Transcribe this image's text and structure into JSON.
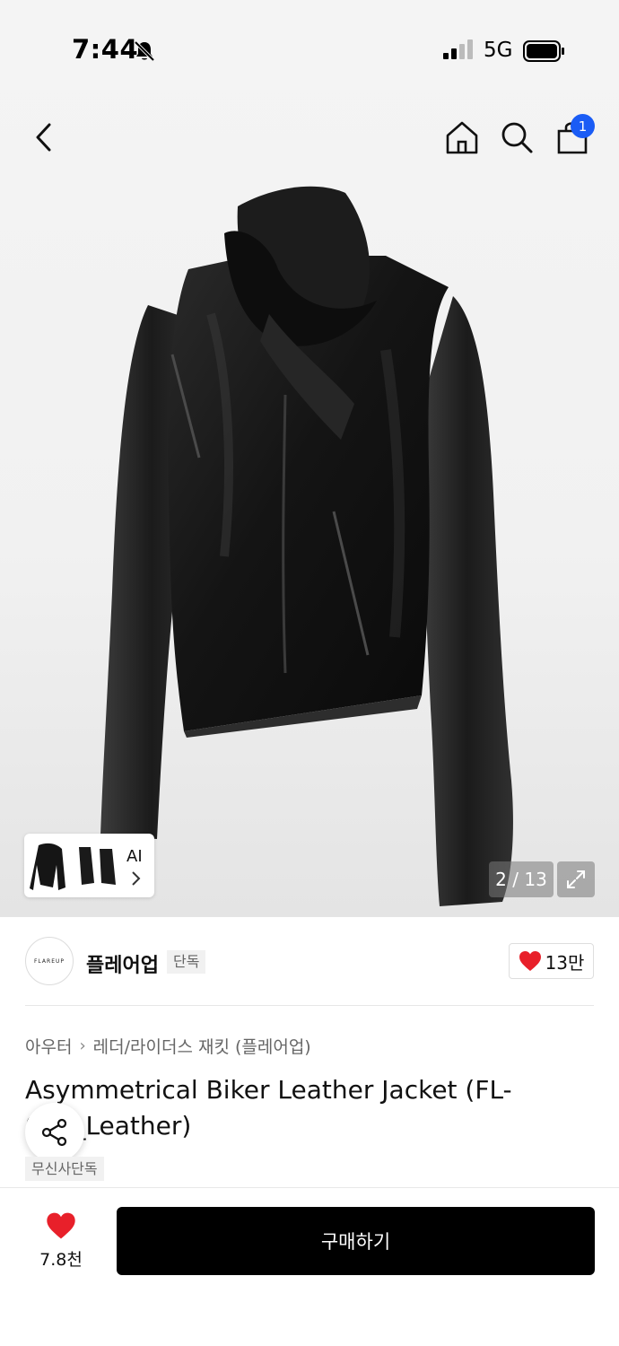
{
  "status_bar": {
    "time": "7:44",
    "network": "5G"
  },
  "header": {
    "cart_count": "1"
  },
  "gallery": {
    "ai_label": "AI",
    "counter": "2 / 13"
  },
  "brand": {
    "logo_text": "FLAREUP",
    "name": "플레어업",
    "badge": "단독",
    "likes": "13만"
  },
  "product": {
    "category": [
      "아우터",
      "레더/라이더스 재킷 (플레어업)"
    ],
    "title": "Asymmetrical Biker Leather Jacket (FL-047_Leather)",
    "exclusive_badge": "무신사단독"
  },
  "bottom_bar": {
    "wish_count": "7.8천",
    "buy_label": "구매하기"
  },
  "colors": {
    "accent_blue": "#1a5cf5",
    "heart_red": "#e8202a",
    "button_black": "#000000"
  }
}
